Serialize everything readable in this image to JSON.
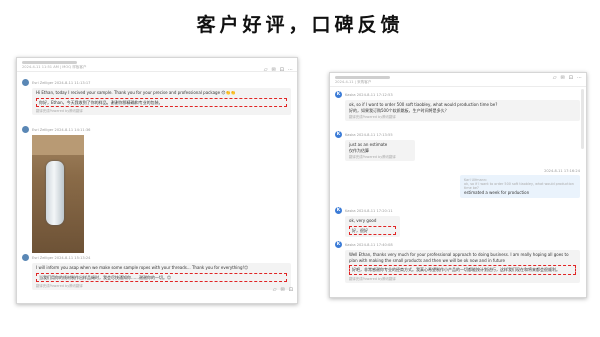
{
  "page": {
    "title": "客户好评，口碑反馈"
  },
  "left": {
    "header_sub": "2024-4-11 11:51 AM | MOQ 样板客户",
    "tools": [
      "▱",
      "✉",
      "⊡",
      "⋯"
    ],
    "messages": [
      {
        "time": "Esri Zelliger 2024-8-11 11:13:17",
        "text": "Hi Ethan, today I recived your sample. Thank you for your precise and professional package 😍👏👏",
        "translation": "你好，Ethan，今天我收到了你的样品。谢谢你那精确和专业的包装。",
        "translate_label": "翻译完成Powered by腾讯翻译"
      },
      {
        "time": "Esri Zelliger 2024-8-11 14:11:36"
      },
      {
        "time": "Esri Zelliger 2024-8-11 15:13:24",
        "text": "I will inform you asap when we make some sample ropes with your threads... Thank you for everything!😊",
        "translation": "当我们用你的线材制作出样品绳时，我会尽快通知你……谢谢你的一切。😊",
        "translate_label": "翻译完成Powered by腾讯翻译"
      }
    ]
  },
  "right": {
    "header_sub": "2024-4-11 | 采购客户",
    "tools": [
      "▱",
      "✉",
      "⊡",
      "⋯"
    ],
    "messages": [
      {
        "avatar": "K",
        "time": "Kaska 2024-8-11 17:12:53",
        "text": "ok, so if I want to order 500 soft tiaobley, what would production time be?",
        "translation": "好的，如果我订购500个软质跳板，生产时间将是多久？",
        "translate_label": "翻译完成Powered by腾讯翻译"
      },
      {
        "avatar": "K",
        "time": "Kaska 2024-8-11 17:13:55",
        "text": "just as an estimate",
        "translation": "仅作为估算",
        "translate_label": "翻译完成Powered by腾讯翻译"
      },
      {
        "time": "2024-8-11 17:16:24",
        "quote": "Karl Ulfmann:\nok, so if I want to order 500 soft tiaobley, what would production time be?",
        "text": "estimated a week for production"
      },
      {
        "avatar": "K",
        "time": "Kaska 2024-8-11 17:20:11",
        "text": "ok, very good",
        "translation": "好，很好"
      },
      {
        "avatar": "K",
        "time": "Kaska 2024-8-11 17:40:08",
        "text": "Well Ethan, thanks very much for your professional approach to doing business. I am really hoping all goes to plan with making the small products and then we will be ok now and in future",
        "translation": "好吧，非常感谢你专业的经商方式。我真心希望制作小产品的一切都能按计划进行，这样我们现在和将来都会很顺利。",
        "translate_label": "翻译完成Powered by腾讯翻译"
      }
    ]
  }
}
